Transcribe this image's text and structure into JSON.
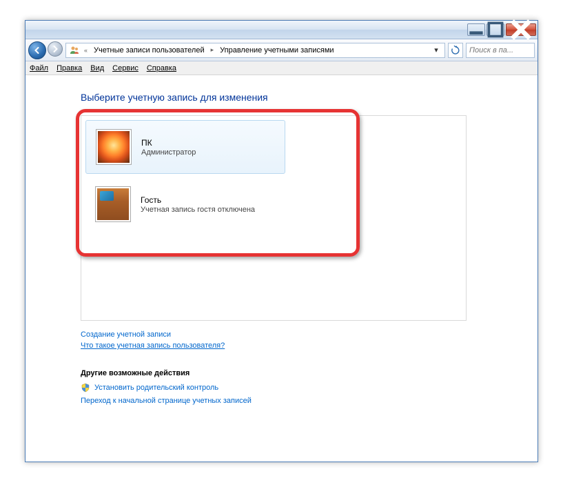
{
  "breadcrumb": {
    "chevrons": "«",
    "items": [
      "Учетные записи пользователей",
      "Управление учетными записями"
    ]
  },
  "search": {
    "placeholder": "Поиск в па..."
  },
  "menu": {
    "file": "Файл",
    "edit": "Правка",
    "view": "Вид",
    "tools": "Сервис",
    "help": "Справка"
  },
  "heading": "Выберите учетную запись для изменения",
  "accounts": [
    {
      "name": "ПК",
      "role": "Администратор"
    },
    {
      "name": "Гость",
      "role": "Учетная запись гостя отключена"
    }
  ],
  "links": {
    "create": "Создание учетной записи",
    "whatis": "Что такое учетная запись пользователя?"
  },
  "other": {
    "heading": "Другие возможные действия",
    "parental": "Установить родительский контроль",
    "gohome": "Переход к начальной странице учетных записей"
  }
}
